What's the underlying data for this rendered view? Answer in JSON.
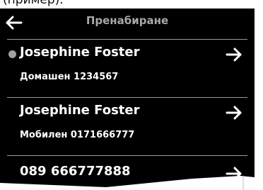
{
  "caption": "(пример).",
  "header": {
    "title": "Пренабиране",
    "back_icon": "arrow-left-icon"
  },
  "entries": [
    {
      "name": "Josephine Foster",
      "detail": "Домашен 1234567",
      "marked": true,
      "arrow_icon": "arrow-right-icon"
    },
    {
      "name": "Josephine Foster",
      "detail": "Мобилен 0171666777",
      "marked": false,
      "arrow_icon": "arrow-right-icon"
    },
    {
      "name": "089 666777888",
      "detail": "",
      "marked": false,
      "arrow_icon": "arrow-right-icon"
    }
  ],
  "colors": {
    "background": "#000000",
    "text": "#ffffff",
    "title": "#a8a8a8",
    "divider": "#9a9a9a",
    "marker": "#a0a0a0"
  }
}
